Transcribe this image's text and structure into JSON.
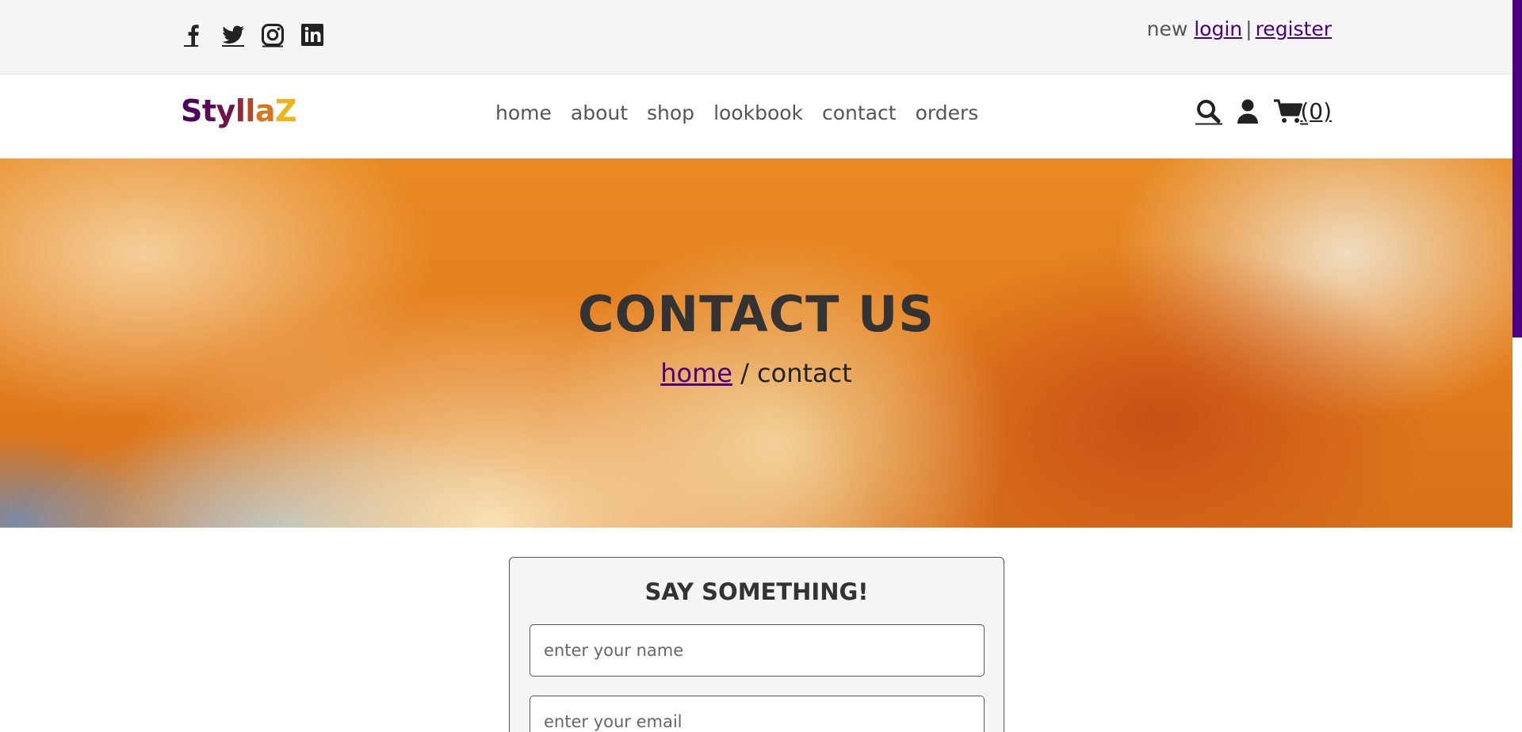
{
  "top_bar": {
    "social": [
      "facebook-icon",
      "twitter-icon",
      "instagram-icon",
      "linkedin-icon"
    ],
    "auth_prefix": "new",
    "login": "login",
    "separator": "|",
    "register": "register"
  },
  "header": {
    "logo_letters": [
      "S",
      "t",
      "y",
      "l",
      "l",
      "a",
      "Z"
    ],
    "nav": [
      "home",
      "about",
      "shop",
      "lookbook",
      "contact",
      "orders"
    ],
    "cart_count": "(0)"
  },
  "banner": {
    "title": "CONTACT US",
    "breadcrumb_home": "home",
    "breadcrumb_rest": " / contact"
  },
  "form": {
    "title": "SAY SOMETHING!",
    "name_placeholder": "enter your name",
    "email_placeholder": "enter your email"
  },
  "colors": {
    "accent": "#4b0082",
    "topbar_bg": "#f5f5f5"
  }
}
